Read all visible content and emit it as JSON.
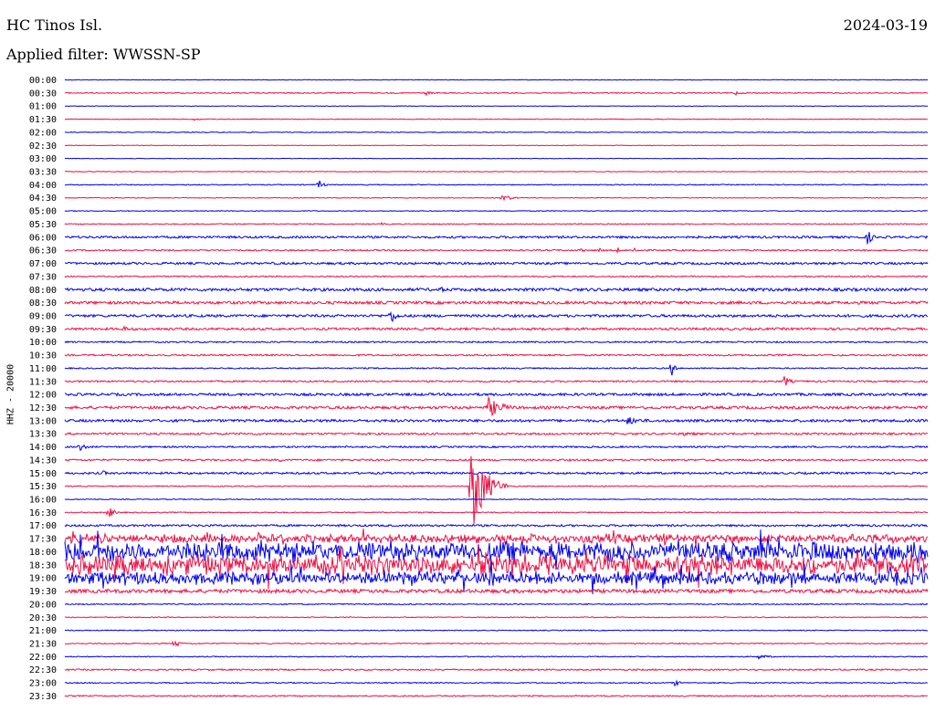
{
  "header": {
    "station": "HC Tinos Isl.",
    "date": "2024-03-19",
    "filter": "Applied filter: WWSSN-SP"
  },
  "chart_data": {
    "type": "helicorder",
    "ylabel": "HHZ - 20000",
    "row_labels": [
      "00:00",
      "00:30",
      "01:00",
      "01:30",
      "02:00",
      "02:30",
      "03:00",
      "03:30",
      "04:00",
      "04:30",
      "05:00",
      "05:30",
      "06:00",
      "06:30",
      "07:00",
      "07:30",
      "08:00",
      "08:30",
      "09:00",
      "09:30",
      "10:00",
      "10:30",
      "11:00",
      "11:30",
      "12:00",
      "12:30",
      "13:00",
      "13:30",
      "14:00",
      "14:30",
      "15:00",
      "15:30",
      "16:00",
      "16:30",
      "17:00",
      "17:30",
      "18:00",
      "18:30",
      "19:00",
      "19:30",
      "20:00",
      "20:30",
      "21:00",
      "21:30",
      "22:00",
      "22:30",
      "23:00",
      "23:30"
    ],
    "colors": [
      "#0000ee",
      "#ee1144"
    ],
    "row_minutes": 30,
    "noise_level": [
      0.3,
      0.6,
      0.3,
      0.4,
      0.4,
      0.3,
      0.3,
      0.4,
      0.5,
      0.4,
      0.4,
      0.6,
      1.2,
      0.8,
      1.2,
      0.7,
      1.6,
      1.6,
      1.4,
      1.3,
      0.8,
      0.9,
      0.7,
      0.9,
      1.4,
      1.5,
      1.4,
      1.1,
      0.9,
      1.0,
      1.1,
      0.6,
      0.5,
      0.6,
      1.1,
      4.0,
      9.0,
      9.0,
      6.0,
      2.0,
      0.6,
      0.5,
      0.5,
      0.6,
      0.5,
      0.8,
      0.6,
      0.7
    ],
    "events": [
      {
        "row": 1,
        "minute": 12.5,
        "amp": 3,
        "dur": 0.7
      },
      {
        "row": 1,
        "minute": 17.5,
        "amp": 2,
        "dur": 0.5
      },
      {
        "row": 1,
        "minute": 23.3,
        "amp": 3,
        "dur": 0.5
      },
      {
        "row": 3,
        "minute": 4.5,
        "amp": 2,
        "dur": 0.6
      },
      {
        "row": 8,
        "minute": 8.8,
        "amp": 6,
        "dur": 0.5
      },
      {
        "row": 9,
        "minute": 15.2,
        "amp": 4,
        "dur": 0.9
      },
      {
        "row": 11,
        "minute": 11.0,
        "amp": 2,
        "dur": 0.4
      },
      {
        "row": 12,
        "minute": 27.9,
        "amp": 9,
        "dur": 0.5
      },
      {
        "row": 13,
        "minute": 18.0,
        "amp": 5,
        "dur": 0.2
      },
      {
        "row": 13,
        "minute": 18.6,
        "amp": 5,
        "dur": 0.2
      },
      {
        "row": 13,
        "minute": 19.2,
        "amp": 5,
        "dur": 0.2
      },
      {
        "row": 13,
        "minute": 19.8,
        "amp": 5,
        "dur": 0.2
      },
      {
        "row": 16,
        "minute": 13.0,
        "amp": 4,
        "dur": 0.8
      },
      {
        "row": 18,
        "minute": 11.3,
        "amp": 10,
        "dur": 0.6
      },
      {
        "row": 19,
        "minute": 2.0,
        "amp": 3,
        "dur": 1.6
      },
      {
        "row": 22,
        "minute": 21.1,
        "amp": 15,
        "dur": 0.2
      },
      {
        "row": 23,
        "minute": 25.0,
        "amp": 8,
        "dur": 0.5
      },
      {
        "row": 25,
        "minute": 14.7,
        "amp": 12,
        "dur": 1.4
      },
      {
        "row": 26,
        "minute": 19.5,
        "amp": 5,
        "dur": 1.8
      },
      {
        "row": 27,
        "minute": 21.5,
        "amp": 3,
        "dur": 1.5
      },
      {
        "row": 28,
        "minute": 0.5,
        "amp": 7,
        "dur": 0.5
      },
      {
        "row": 29,
        "minute": 7.4,
        "amp": 4,
        "dur": 0.4
      },
      {
        "row": 30,
        "minute": 1.3,
        "amp": 3,
        "dur": 0.8
      },
      {
        "row": 31,
        "minute": 14.1,
        "amp": 60,
        "dur": 1.2
      },
      {
        "row": 33,
        "minute": 1.5,
        "amp": 8,
        "dur": 0.5
      },
      {
        "row": 38,
        "minute": 14.8,
        "amp": 35,
        "dur": 0.2
      },
      {
        "row": 43,
        "minute": 3.8,
        "amp": 7,
        "dur": 0.4
      },
      {
        "row": 44,
        "minute": 24.1,
        "amp": 3,
        "dur": 1.0
      },
      {
        "row": 46,
        "minute": 21.2,
        "amp": 4,
        "dur": 0.5
      }
    ]
  }
}
